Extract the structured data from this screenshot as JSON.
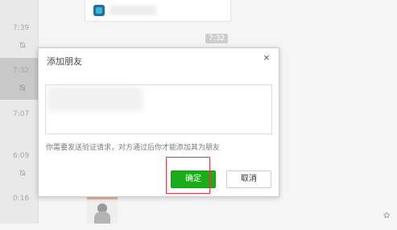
{
  "sessions": [
    {
      "time": "7:39",
      "muted": true
    },
    {
      "time": "7:32",
      "muted": true,
      "selected": true
    },
    {
      "time": "7:07",
      "muted": false
    },
    {
      "time": "6:09",
      "muted": true
    },
    {
      "time": "0:16",
      "muted": false
    }
  ],
  "chat": {
    "time_label": "7:32"
  },
  "dialog": {
    "title": "添加朋友",
    "close_glyph": "×",
    "hint": "你需要发送验证请求，对方通过后你才能添加其为朋友",
    "confirm_label": "确定",
    "cancel_label": "取消"
  },
  "colors": {
    "confirm_green": "#1aad19",
    "highlight_red": "#e3393c"
  },
  "icons": {
    "mute": "bell-off-icon",
    "close": "close-icon"
  }
}
